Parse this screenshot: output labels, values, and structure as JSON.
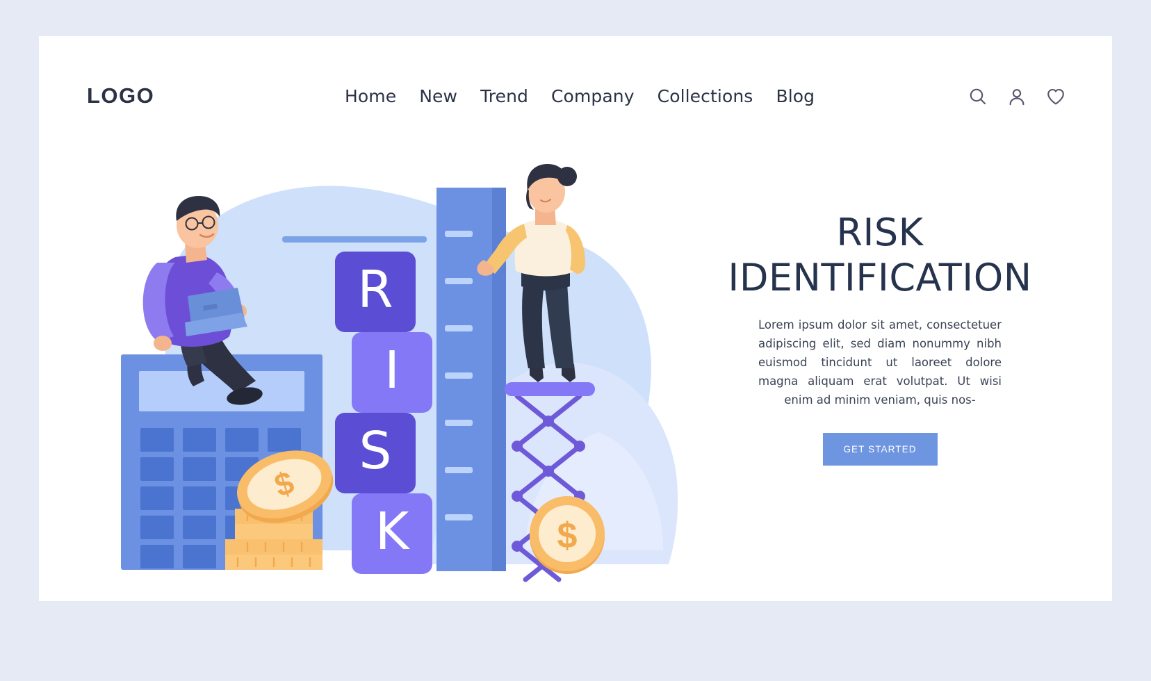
{
  "brand": {
    "logo_text": "LOGO"
  },
  "nav": {
    "items": [
      {
        "label": "Home"
      },
      {
        "label": "New"
      },
      {
        "label": "Trend"
      },
      {
        "label": "Company"
      },
      {
        "label": "Collections"
      },
      {
        "label": "Blog"
      }
    ]
  },
  "header_icons": [
    {
      "name": "search-icon"
    },
    {
      "name": "user-icon"
    },
    {
      "name": "heart-icon"
    }
  ],
  "hero": {
    "title_line_1": "RISK",
    "title_line_2": "IDENTIFICATION",
    "paragraph": "Lorem ipsum dolor sit amet, consectetuer adipiscing elit, sed diam nonummy nibh euismod tincidunt ut laoreet dolore magna aliquam erat volutpat. Ut wisi enim ad minim veniam, quis nos-",
    "cta_label": "GET STARTED"
  },
  "illustration": {
    "blocks": [
      {
        "letter": "R",
        "shade": "dark"
      },
      {
        "letter": "I",
        "shade": "light"
      },
      {
        "letter": "S",
        "shade": "dark"
      },
      {
        "letter": "K",
        "shade": "light"
      }
    ],
    "coin_symbol": "$",
    "alt": "Man with laptop sitting on a giant calculator with coin stack, four RISK letter blocks, a tall ruler, and a woman on a scissor lift platform"
  },
  "colors": {
    "page_background": "#e5eaf5",
    "card_background": "#ffffff",
    "text_dark": "#2b3245",
    "heading": "#26334d",
    "accent_blue": "#6e95e0",
    "block_purple_dark": "#5b4ed4",
    "block_purple_light": "#8578f7",
    "calculator_blue": "#6b8fe0",
    "coin_gold": "#f7b25c",
    "blob_blue": "#cfe0fb"
  }
}
